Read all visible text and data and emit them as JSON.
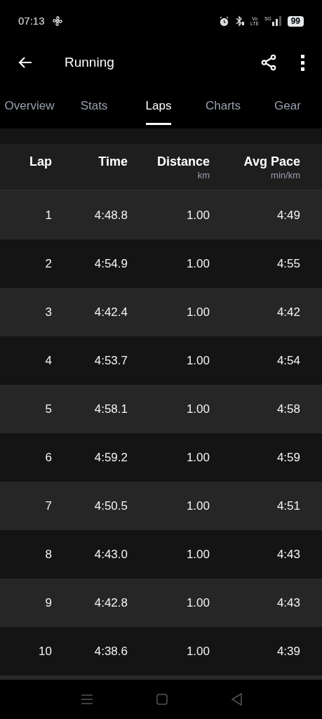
{
  "status_bar": {
    "time": "07:13",
    "volte_top": "Vo",
    "volte_bottom": "LTE",
    "network": "5G",
    "battery": "99"
  },
  "app_bar": {
    "title": "Running"
  },
  "tabs": [
    {
      "label": "Overview",
      "selected": false
    },
    {
      "label": "Stats",
      "selected": false
    },
    {
      "label": "Laps",
      "selected": true
    },
    {
      "label": "Charts",
      "selected": false
    },
    {
      "label": "Gear",
      "selected": false
    }
  ],
  "table": {
    "columns": [
      {
        "label": "Lap"
      },
      {
        "label": "Time"
      },
      {
        "label": "Distance",
        "unit": "km"
      },
      {
        "label": "Avg Pace",
        "unit": "min/km"
      }
    ],
    "rows": [
      [
        "1",
        "4:48.8",
        "1.00",
        "4:49"
      ],
      [
        "2",
        "4:54.9",
        "1.00",
        "4:55"
      ],
      [
        "3",
        "4:42.4",
        "1.00",
        "4:42"
      ],
      [
        "4",
        "4:53.7",
        "1.00",
        "4:54"
      ],
      [
        "5",
        "4:58.1",
        "1.00",
        "4:58"
      ],
      [
        "6",
        "4:59.2",
        "1.00",
        "4:59"
      ],
      [
        "7",
        "4:50.5",
        "1.00",
        "4:51"
      ],
      [
        "8",
        "4:43.0",
        "1.00",
        "4:43"
      ],
      [
        "9",
        "4:42.8",
        "1.00",
        "4:43"
      ],
      [
        "10",
        "4:38.6",
        "1.00",
        "4:39"
      ]
    ]
  }
}
